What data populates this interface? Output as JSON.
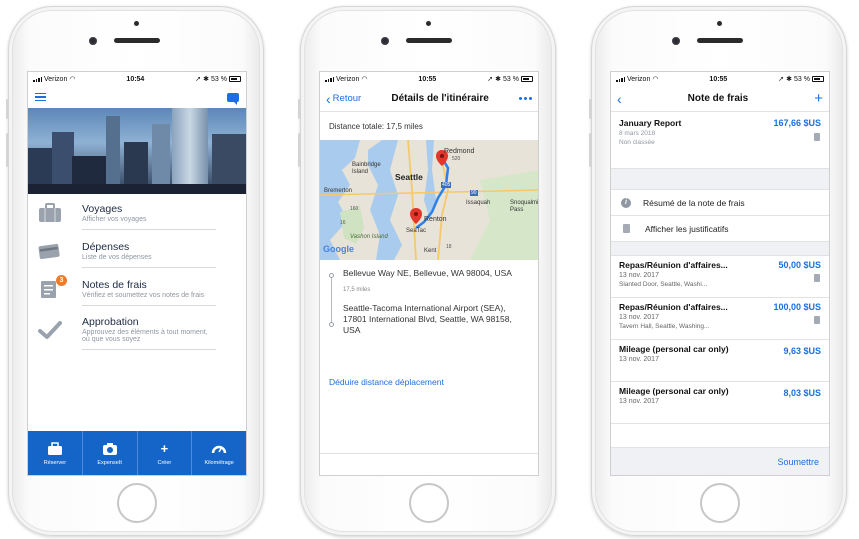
{
  "status_bar": {
    "carrier": "Verizon",
    "battery": "53 %",
    "time1": "10:54",
    "time2": "10:55",
    "time3": "10:55"
  },
  "screen1": {
    "menu": [
      {
        "title": "Voyages",
        "subtitle": "Afficher vos voyages",
        "icon": "briefcase-icon"
      },
      {
        "title": "Dépenses",
        "subtitle": "Liste de vos dépenses",
        "icon": "credit-card-icon"
      },
      {
        "title": "Notes de frais",
        "subtitle": "Vérifiez et soumettez vos notes de frais",
        "icon": "report-icon",
        "badge": "3"
      },
      {
        "title": "Approbation",
        "subtitle": "Approuvez des éléments à tout moment, où que vous soyez",
        "icon": "checkmark-icon"
      }
    ],
    "tabs": [
      {
        "label": "Réserver",
        "icon": "suitcase-icon"
      },
      {
        "label": "ExpenseIt",
        "icon": "camera-icon"
      },
      {
        "label": "Créer",
        "icon": "plus-icon"
      },
      {
        "label": "Kilométrage",
        "icon": "gauge-icon"
      }
    ]
  },
  "screen2": {
    "back_label": "Retour",
    "title": "Détails de l'itinéraire",
    "distance_total": "Distance totale: 17,5 miles",
    "map_labels": {
      "redmond": "Redmond",
      "bainbridge": "Bainbridge Island",
      "seattle": "Seattle",
      "bremerton": "Bremerton",
      "issaquah": "Issaquah",
      "snoqualmie": "Snoqualmie Pass",
      "renton": "Renton",
      "seatac": "SeaTac",
      "vashon": "Vashon Island",
      "kent": "Kent",
      "google": "Google",
      "r520": "520",
      "r405": "405",
      "r160": "160",
      "r90": "90",
      "r18": "18",
      "r16": "16"
    },
    "origin": "Bellevue Way NE, Bellevue, WA 98004, USA",
    "route_distance": "17,5 miles",
    "destination": "Seattle-Tacoma International Airport (SEA), 17801 International Blvd, Seattle, WA 98158, USA",
    "action_link": "Déduire distance déplacement"
  },
  "screen3": {
    "title": "Note de frais",
    "report": {
      "name": "January Report",
      "date": "8 mars 2018",
      "status": "Non classée",
      "amount": "167,66 $US"
    },
    "actions": [
      {
        "label": "Résumé de la note de frais",
        "icon": "info-icon"
      },
      {
        "label": "Afficher les justificatifs",
        "icon": "document-icon"
      }
    ],
    "expenses": [
      {
        "name": "Repas/Réunion d'affaires...",
        "date": "13 nov. 2017",
        "location": "Slanted Door, Seattle, Washi...",
        "amount": "50,00 $US",
        "receipt": true
      },
      {
        "name": "Repas/Réunion d'affaires...",
        "date": "13 nov. 2017",
        "location": "Tavern Hall, Seattle, Washing...",
        "amount": "100,00 $US",
        "receipt": true
      },
      {
        "name": "Mileage (personal car only)",
        "date": "13 nov. 2017",
        "location": "",
        "amount": "9,63 $US",
        "receipt": false
      },
      {
        "name": "Mileage (personal car only)",
        "date": "13 nov. 2017",
        "location": "",
        "amount": "8,03 $US",
        "receipt": false
      }
    ],
    "submit_label": "Soumettre"
  },
  "colors": {
    "accent": "#1d6fe0",
    "tabbar": "#1565c8",
    "badge": "#f07a2a"
  }
}
